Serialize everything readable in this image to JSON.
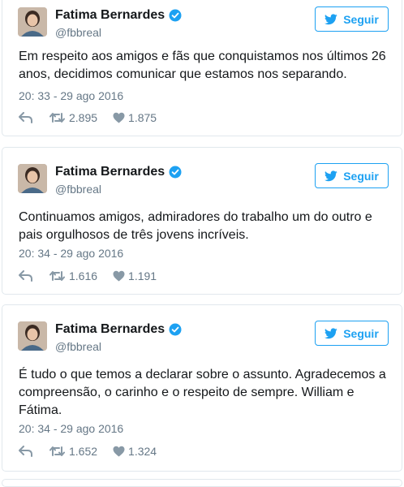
{
  "colors": {
    "accent": "#1da1f2",
    "muted": "#657786",
    "border": "#e1e8ed",
    "text": "#14171a"
  },
  "tweets": [
    {
      "name": "Fatima Bernardes",
      "handle": "@fbbreal",
      "follow_label": "Seguir",
      "text": "Em respeito aos amigos e fãs que conquistamos nos últimos 26 anos, decidimos comunicar que estamos nos separando.",
      "timestamp": "20: 33 - 29 ago 2016",
      "retweets": "2.895",
      "likes": "1.875",
      "icons": [
        "verified-badge-icon",
        "twitter-bird-icon",
        "reply-icon",
        "retweet-icon",
        "heart-icon"
      ]
    },
    {
      "name": "Fatima Bernardes",
      "handle": "@fbbreal",
      "follow_label": "Seguir",
      "text": "Continuamos amigos, admiradores do trabalho um do outro e pais orgulhosos de três jovens incríveis.",
      "timestamp": "20: 34 - 29 ago 2016",
      "retweets": "1.616",
      "likes": "1.191",
      "icons": [
        "verified-badge-icon",
        "twitter-bird-icon",
        "reply-icon",
        "retweet-icon",
        "heart-icon"
      ]
    },
    {
      "name": "Fatima Bernardes",
      "handle": "@fbbreal",
      "follow_label": "Seguir",
      "text": "É tudo o que temos a declarar sobre o assunto. Agradecemos a compreensão, o carinho e o respeito de sempre. William e Fátima.",
      "timestamp": "20: 34 - 29 ago 2016",
      "retweets": "1.652",
      "likes": "1.324",
      "icons": [
        "verified-badge-icon",
        "twitter-bird-icon",
        "reply-icon",
        "retweet-icon",
        "heart-icon"
      ]
    }
  ]
}
